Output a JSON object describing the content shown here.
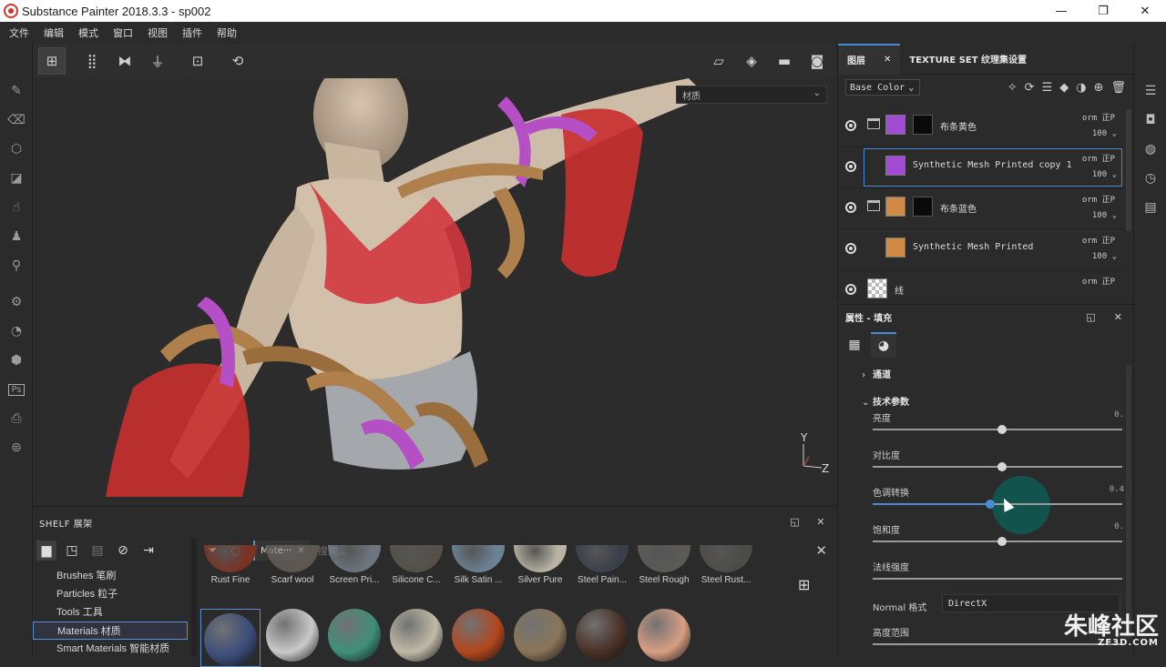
{
  "window": {
    "title": "Substance Painter 2018.3.3 - sp002",
    "minimize": "—",
    "maximize": "❐",
    "close": "✕"
  },
  "menu": [
    "文件",
    "编辑",
    "模式",
    "窗口",
    "视图",
    "插件",
    "帮助"
  ],
  "viewport": {
    "material_mode": "材质",
    "axis_y": "Y",
    "axis_z": "Z"
  },
  "shelf": {
    "title": "SHELF 展架",
    "categories": [
      "Brushes 笔刷",
      "Particles 粒子",
      "Tools 工具",
      "Materials 材质",
      "Smart Materials 智能材质"
    ],
    "selected_category": 3,
    "filter_chip": "Mate···",
    "search_placeholder": "搜索...",
    "materials": [
      {
        "label": "Rust Fine",
        "color": "#7a3222"
      },
      {
        "label": "Scarf wool",
        "color": "#5d5750"
      },
      {
        "label": "Screen Pri...",
        "color": "#6d7680"
      },
      {
        "label": "Silicone C...",
        "color": "#55514a"
      },
      {
        "label": "Silk Satin ...",
        "color": "#6b8296"
      },
      {
        "label": "Silver Pure",
        "color": "#b9b3a3"
      },
      {
        "label": "Steel Pain...",
        "color": "#3a404a"
      },
      {
        "label": "Steel Rough",
        "color": "#5c5a56"
      },
      {
        "label": "Steel Rust...",
        "color": "#4d4b48"
      }
    ],
    "materials_row2": [
      "#3a4c7a",
      "#c9c9c9",
      "#3e8f79",
      "#bfb9a6",
      "#b2471e",
      "#8a7558",
      "#4a3026",
      "#d89e82"
    ]
  },
  "layers_panel": {
    "tabs": [
      "图层",
      "TEXTURE SET 纹理集设置"
    ],
    "channel": "Base Color",
    "layers": [
      {
        "name": "布条黄色",
        "blend": "orm 正P",
        "opacity": "100",
        "color": "#a34bd6",
        "folder": true,
        "mask": true,
        "selected": false
      },
      {
        "name": "Synthetic Mesh Printed copy 1",
        "blend": "orm 正P",
        "opacity": "100",
        "color": "#a34bd6",
        "folder": false,
        "mask": false,
        "selected": true
      },
      {
        "name": "布条蓝色",
        "blend": "orm 正P",
        "opacity": "100",
        "color": "#d08a45",
        "folder": true,
        "mask": true,
        "selected": false
      },
      {
        "name": "Synthetic Mesh Printed",
        "blend": "orm 正P",
        "opacity": "100",
        "color": "#d08a45",
        "folder": false,
        "mask": false,
        "selected": false
      },
      {
        "name": "线",
        "blend": "orm 正P",
        "opacity": "",
        "color": "checker",
        "folder": false,
        "mask": false,
        "selected": false
      }
    ]
  },
  "properties": {
    "title": "属性 - 填充",
    "sections": {
      "channels": "通道",
      "tech": "技术参数"
    },
    "params": [
      {
        "label": "亮度",
        "value": "0.",
        "level": 0.52
      },
      {
        "label": "对比度",
        "value": "",
        "level": 0.52
      },
      {
        "label": "色调转换",
        "value": "0.4",
        "level": 0.47,
        "active": true
      },
      {
        "label": "饱和度",
        "value": "0.",
        "level": 0.52
      },
      {
        "label": "法线强度",
        "value": "",
        "level": null
      }
    ],
    "normal_label": "Normal 格式",
    "normal_value": "DirectX",
    "height_label": "高度范围"
  },
  "watermark": {
    "main": "朱峰社区",
    "sub": "ZF3D.COM"
  },
  "colors": {
    "accent": "#4a8bd6",
    "background": "#2b2b2b"
  }
}
